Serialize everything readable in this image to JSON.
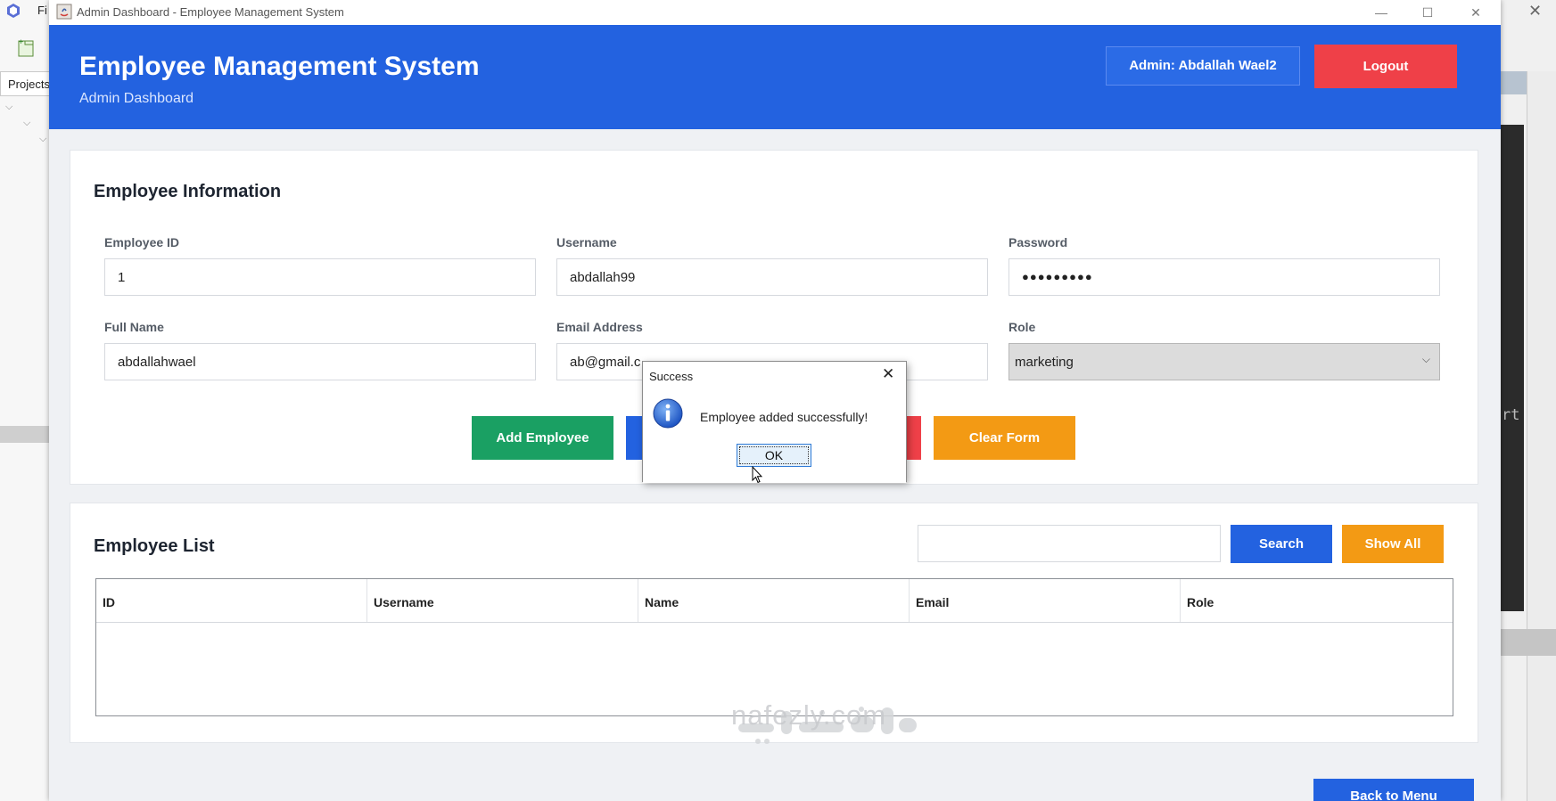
{
  "ide": {
    "menu": "Fi",
    "projects_tab": "Projects",
    "console_fragment": "rt"
  },
  "window": {
    "title": "Admin Dashboard - Employee Management System",
    "controls": {
      "minimize": "—",
      "maximize": "☐",
      "close": "✕"
    }
  },
  "header": {
    "title": "Employee Management System",
    "subtitle": "Admin Dashboard",
    "admin_label": "Admin: Abdallah Wael2",
    "logout": "Logout"
  },
  "employee_info": {
    "title": "Employee Information",
    "fields": {
      "employee_id": {
        "label": "Employee ID",
        "value": "1"
      },
      "username": {
        "label": "Username",
        "value": "abdallah99"
      },
      "password": {
        "label": "Password",
        "value": "●●●●●●●●●"
      },
      "full_name": {
        "label": "Full Name",
        "value": "abdallahwael"
      },
      "email": {
        "label": "Email Address",
        "value": "ab@gmail.c"
      },
      "role": {
        "label": "Role",
        "value": "marketing"
      }
    },
    "buttons": {
      "add": "Add Employee",
      "clear": "Clear Form"
    }
  },
  "employee_list": {
    "title": "Employee List",
    "search_placeholder": "",
    "search": "Search",
    "show_all": "Show All",
    "columns": [
      "ID",
      "Username",
      "Name",
      "Email",
      "Role"
    ]
  },
  "footer": {
    "back": "Back to Menu"
  },
  "watermark": "nafezly.com",
  "dialog": {
    "title": "Success",
    "message": "Employee added successfully!",
    "ok": "OK"
  },
  "colors": {
    "primary": "#2362e0",
    "success": "#1aa063",
    "danger": "#ef4048",
    "warning": "#f39a14"
  }
}
